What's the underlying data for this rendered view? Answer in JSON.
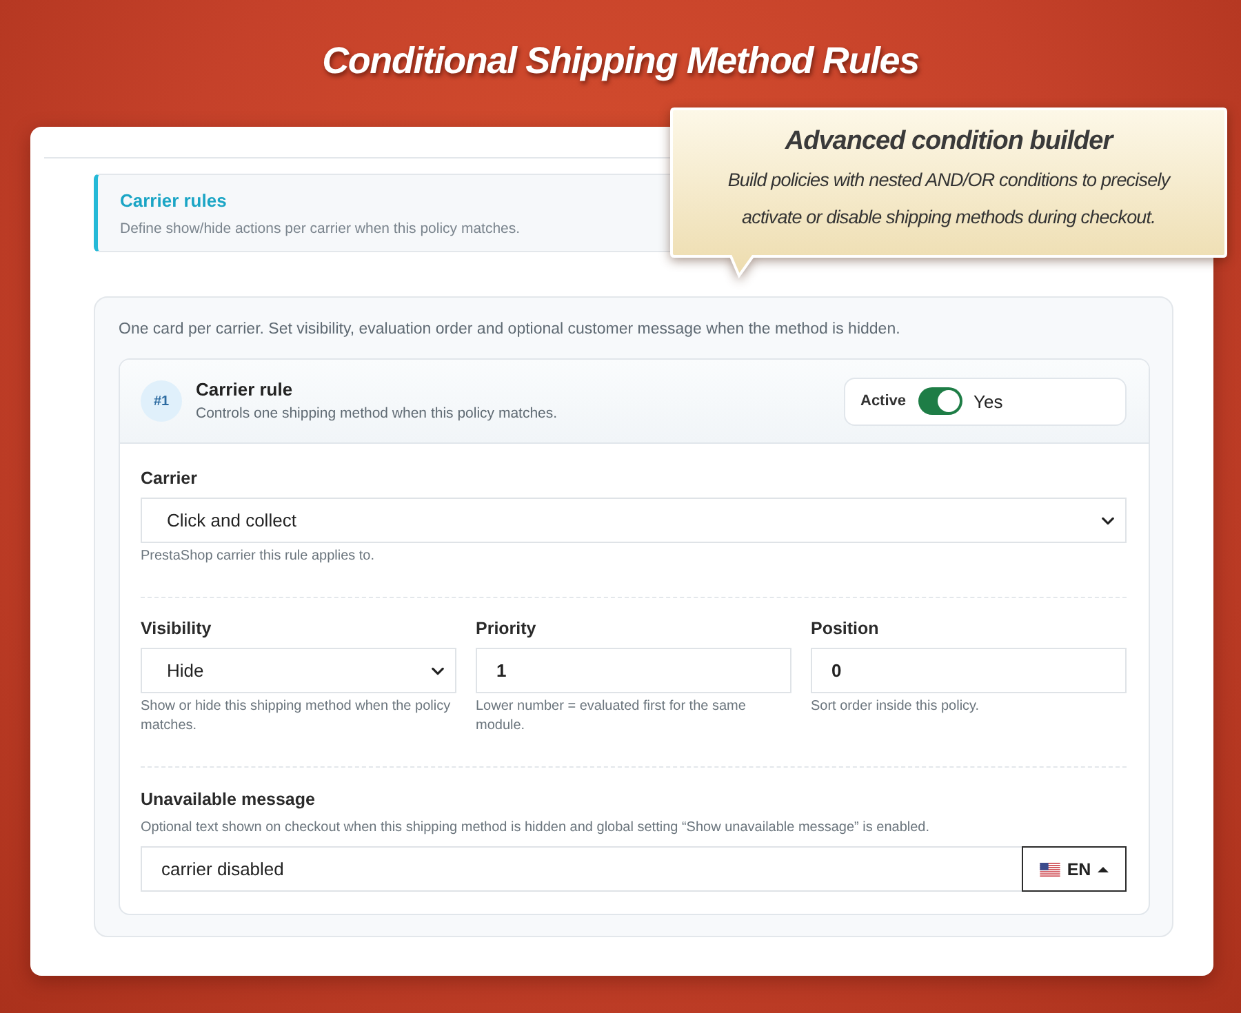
{
  "banner": {
    "title": "Conditional Shipping Method Rules"
  },
  "callout": {
    "title": "Advanced condition builder",
    "text": "Build policies with nested AND/OR conditions to precisely activate or disable shipping methods during checkout."
  },
  "section": {
    "title": "Carrier rules",
    "subtitle": "Define show/hide actions per carrier when this policy matches."
  },
  "intro": "One card per carrier. Set visibility, evaluation order and optional customer message when the method is hidden.",
  "rules": [
    {
      "badge": "#1",
      "title": "Carrier rule",
      "subtitle": "Controls one shipping method when this policy matches.",
      "active": {
        "label": "Active",
        "on": true,
        "value": "Yes"
      },
      "carrier": {
        "kind": "select",
        "label": "Carrier",
        "value": "Click and collect",
        "help": "PrestaShop carrier this rule applies to."
      },
      "settings": [
        {
          "kind": "select",
          "label": "Visibility",
          "value": "Hide",
          "help": "Show or hide this shipping method when the policy matches."
        },
        {
          "kind": "input",
          "label": "Priority",
          "value": "1",
          "help": "Lower number = evaluated first for the same module."
        },
        {
          "kind": "input",
          "label": "Position",
          "value": "0",
          "help": "Sort order inside this policy."
        }
      ],
      "message": {
        "label": "Unavailable message",
        "help": "Optional text shown on checkout when this shipping method is hidden and global setting “Show unavailable message” is enabled.",
        "value": "carrier disabled",
        "language": "EN"
      }
    }
  ]
}
